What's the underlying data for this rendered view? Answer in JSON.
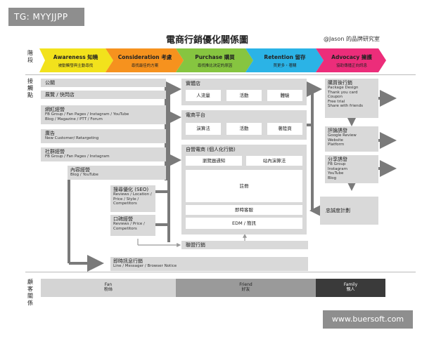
{
  "watermark_tag": "TG: MYYJJPP",
  "title": "電商行銷優化關係圖",
  "author": "@Jason 的品牌研究室",
  "row_labels": {
    "stage": "階段",
    "touchpoints": "接觸點",
    "customer_relation": "顧客關係"
  },
  "stages": [
    {
      "title": "Awareness 知曉",
      "subtitle": "被動觸發與主動尋找",
      "color": "#f2e21c"
    },
    {
      "title": "Consideration 考慮",
      "subtitle": "尋找最佳的方案",
      "color": "#f6921e"
    },
    {
      "title": "Purchase 購買",
      "subtitle": "尋找推比決定的原因",
      "color": "#86c540"
    },
    {
      "title": "Retention 留存",
      "subtitle": "買更多・著購",
      "color": "#2bb3e6"
    },
    {
      "title": "Advocacy 擁護",
      "subtitle": "協助傳播正向訊息",
      "color": "#ec2d7a"
    }
  ],
  "left_channels": [
    {
      "label": "公關",
      "sub": ""
    },
    {
      "label": "展覽 / 快閃店",
      "sub": ""
    },
    {
      "label": "網紅經營",
      "sub": "FB Group / Fan Pages / Instagram / YouTube\nBlog / Magazine / PTT / Forum"
    },
    {
      "label": "廣告",
      "sub": "New Customer/ Retargeting"
    },
    {
      "label": "社群經營",
      "sub": "FB Group / Fan Pages / Instagram"
    },
    {
      "label": "內容經營",
      "sub": "Blog / YouTube"
    }
  ],
  "consideration_channels": [
    {
      "label": "搜尋優化 (SEO)",
      "sub": "Reviews / Location /\nPrice / Style /\nCompetitors"
    },
    {
      "label": "口碑經營",
      "sub": "Reviews / Price /\nCompetitors"
    }
  ],
  "bottom_channels": [
    {
      "label": "聯盟行銷",
      "sub": ""
    },
    {
      "label": "即時訊息行銷",
      "sub": "Line / Messager / Browser Notice"
    }
  ],
  "physical_store": {
    "label": "實體店",
    "items": [
      "人流量",
      "活動",
      "體驗"
    ]
  },
  "ecommerce_platform": {
    "label": "電商平台",
    "items": [
      "演算法",
      "活動",
      "著陸頁"
    ]
  },
  "own_ecommerce": {
    "label": "自營電商 (個人化行銷)",
    "items": [
      "瀏覽器通知",
      "站內演算法"
    ],
    "register": "註冊",
    "instant_service": "即時客服",
    "edm": "EDM / 簡訊"
  },
  "post_purchase": {
    "label": "購買後行銷",
    "sub": "Package Design\nThank you card\nCoupon\nFree trial\nShare with friends"
  },
  "loyalty_plan": "忠誠度計劃",
  "advocacy": [
    {
      "label": "評論誘發",
      "sub": "Google Review\nWebsite\nPlatform"
    },
    {
      "label": "分享誘發",
      "sub": "FB Group\nInstagram\nYouTube\nBlog"
    }
  ],
  "relations": [
    {
      "en": "Fan",
      "zh": "粉絲",
      "color": "#d4d4d4",
      "text_color": "#222222"
    },
    {
      "en": "Friend",
      "zh": "好友",
      "color": "#9a9a9a",
      "text_color": "#222222"
    },
    {
      "en": "Family",
      "zh": "親人",
      "color": "#3a3a3a",
      "text_color": "#ffffff"
    }
  ],
  "site_url": "www.buersoft.com"
}
